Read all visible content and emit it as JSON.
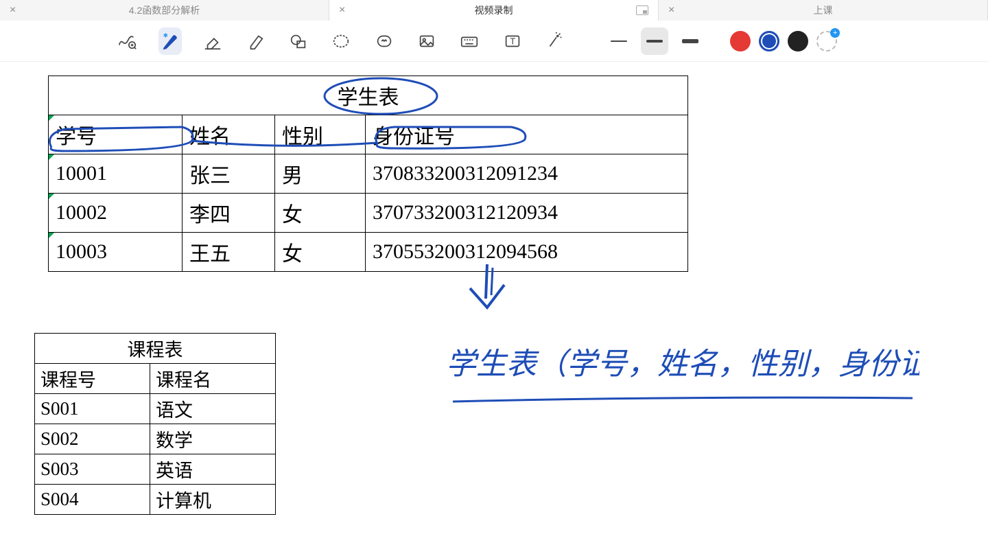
{
  "tabs": [
    {
      "label": "4.2函数部分解析"
    },
    {
      "label": "视频录制"
    },
    {
      "label": "上课"
    }
  ],
  "table1": {
    "title": "学生表",
    "headers": [
      "学号",
      "姓名",
      "性别",
      "身份证号"
    ],
    "rows": [
      [
        "10001",
        "张三",
        "男",
        "370833200312091234"
      ],
      [
        "10002",
        "李四",
        "女",
        "370733200312120934"
      ],
      [
        "10003",
        "王五",
        "女",
        "370553200312094568"
      ]
    ]
  },
  "table2": {
    "title": "课程表",
    "headers": [
      "课程号",
      "课程名"
    ],
    "rows": [
      [
        "S001",
        "语文"
      ],
      [
        "S002",
        "数学"
      ],
      [
        "S003",
        "英语"
      ],
      [
        "S004",
        "计算机"
      ]
    ]
  },
  "handwriting": "学生表（学号，姓名，性别，身份证号）",
  "colors": {
    "ink": "#1e4db7"
  }
}
